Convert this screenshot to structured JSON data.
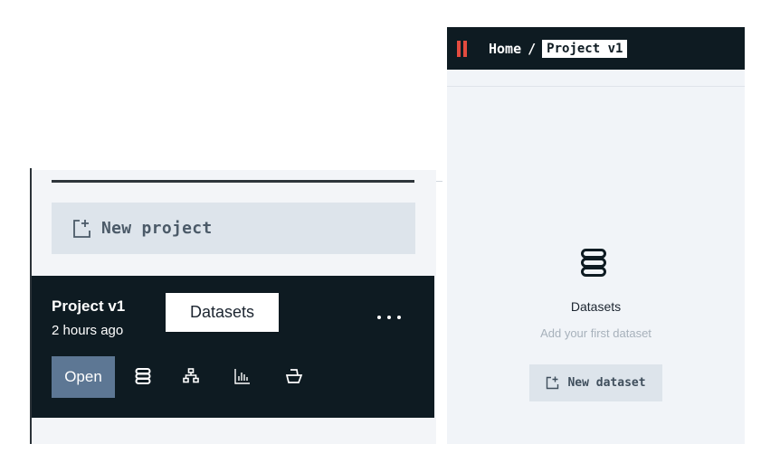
{
  "left_panel": {
    "new_project_label": "New project",
    "project": {
      "title": "Project v1",
      "updated": "2 hours ago",
      "open_label": "Open",
      "actions": [
        "database-icon",
        "sitemap-icon",
        "bar-chart-icon",
        "deploy-icon"
      ]
    },
    "tooltip": "Datasets"
  },
  "topbar": {
    "home": "Home",
    "separator": "/",
    "current": "Project v1"
  },
  "empty_state": {
    "title": "Datasets",
    "subtitle": "Add your first dataset",
    "button_label": "New dataset"
  },
  "colors": {
    "dark": "#0e1b22",
    "accent_open": "#5d7794",
    "logo": "#e34b3f",
    "button_bg": "#dde4eb"
  }
}
